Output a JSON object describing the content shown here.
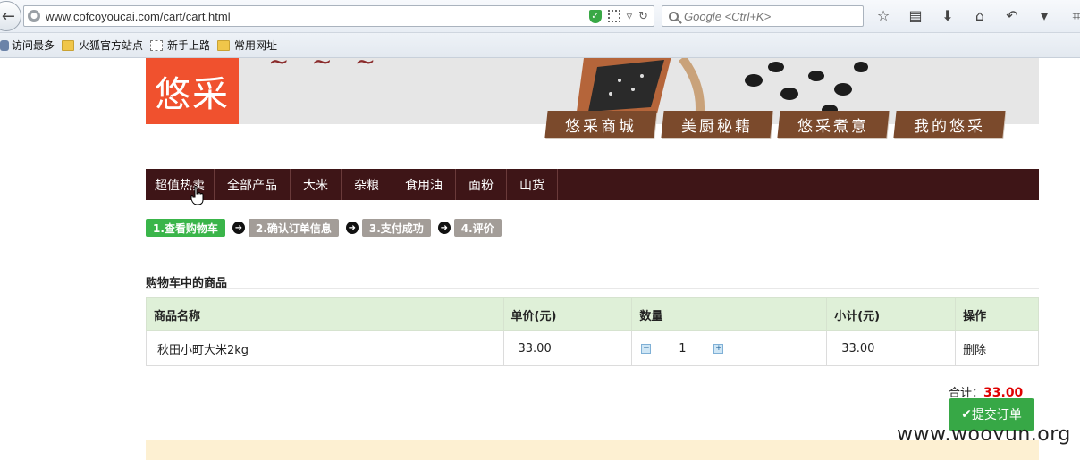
{
  "browser": {
    "url": "www.cofcoyoucai.com/cart/cart.html",
    "search_placeholder": "Google <Ctrl+K>",
    "bookmarks": [
      "访问最多",
      "火狐官方站点",
      "新手上路",
      "常用网址"
    ]
  },
  "site": {
    "logo": "悠采",
    "tabs": [
      "悠采商城",
      "美厨秘籍",
      "悠采煮意",
      "我的悠采"
    ],
    "categories": [
      "超值热卖",
      "全部产品",
      "大米",
      "杂粮",
      "食用油",
      "面粉",
      "山货"
    ]
  },
  "steps": [
    "1.查看购物车",
    "2.确认订单信息",
    "3.支付成功",
    "4.评价"
  ],
  "cart": {
    "title": "购物车中的商品",
    "headers": [
      "商品名称",
      "单价(元)",
      "数量",
      "小计(元)",
      "操作"
    ],
    "rows": [
      {
        "name": "秋田小町大米2kg",
        "price": "33.00",
        "qty": "1",
        "subtotal": "33.00",
        "action": "删除"
      }
    ],
    "total_label": "合计：",
    "total_value": "33.00",
    "submit_label": "提交订单"
  },
  "watermark": "www.wooyun.org",
  "colors": {
    "nav_bg": "#3e1517",
    "logo_bg": "#f0512e",
    "step_active": "#3ab54a",
    "submit": "#37a846",
    "total": "#e00000"
  }
}
